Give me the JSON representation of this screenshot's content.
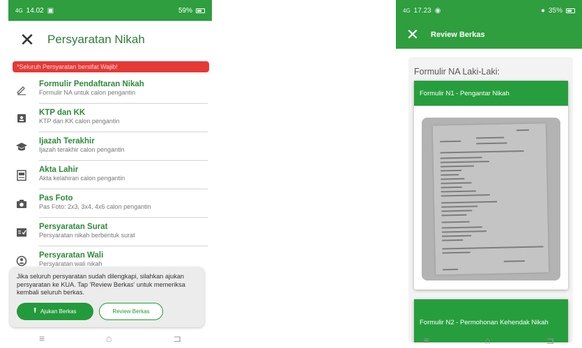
{
  "left_screen": {
    "status_bar": {
      "time": "14.02",
      "signal": "4G",
      "battery": "59%"
    },
    "header": {
      "title": "Persyaratan Nikah"
    },
    "alert": "*Seluruh Persyaratan bersifat Wajib!",
    "requirements": [
      {
        "title": "Formulir Pendaftaran Nikah",
        "subtitle": "Formulir NA untuk calon pengantin",
        "icon": "pen-icon"
      },
      {
        "title": "KTP dan KK",
        "subtitle": "KTP dan KK calon pengantin",
        "icon": "id-card-icon"
      },
      {
        "title": "Ijazah Terakhir",
        "subtitle": "Ijazah terakhir calon pengantin",
        "icon": "graduation-cap-icon"
      },
      {
        "title": "Akta Lahir",
        "subtitle": "Akta kelahiran calon pengantin",
        "icon": "document-icon"
      },
      {
        "title": "Pas Foto",
        "subtitle": "Pas Foto: 2x3, 3x4, 4x6 calon pengantin",
        "icon": "camera-icon"
      },
      {
        "title": "Persyaratan Surat",
        "subtitle": "Persyaratan nikah berbentuk surat",
        "icon": "letter-check-icon"
      },
      {
        "title": "Persyaratan Wali",
        "subtitle": "Persyaratan wali nikah",
        "icon": "guardian-icon"
      }
    ],
    "info_card": {
      "text": "Jika seluruh persyaratan sudah dilengkapi, silahkan ajukan persyaratan ke KUA. Tap 'Review Berkas' untuk memeriksa kembali seluruh berkas.",
      "submit_label": "Ajukan Berkas",
      "review_label": "Review Berkas"
    },
    "nav": {
      "menu": "≡",
      "home": "⌂",
      "back": "⊐"
    }
  },
  "right_screen": {
    "status_bar": {
      "time": "17.23",
      "signal": "4G",
      "battery": "35%"
    },
    "header": {
      "title": "Review Berkas"
    },
    "section_label": "Formulir NA Laki-Laki:",
    "documents": [
      {
        "title": "Formulir N1 - Pengantar Nikah"
      },
      {
        "title": "Formulir N2 - Permohonan Kehendak Nikah"
      }
    ],
    "nav": {
      "menu": "≡",
      "home": "⌂",
      "back": "⊐"
    }
  },
  "colors": {
    "primary_green": "#2e9e3f",
    "accent_green": "#239a3b",
    "alert_red": "#e53935"
  }
}
